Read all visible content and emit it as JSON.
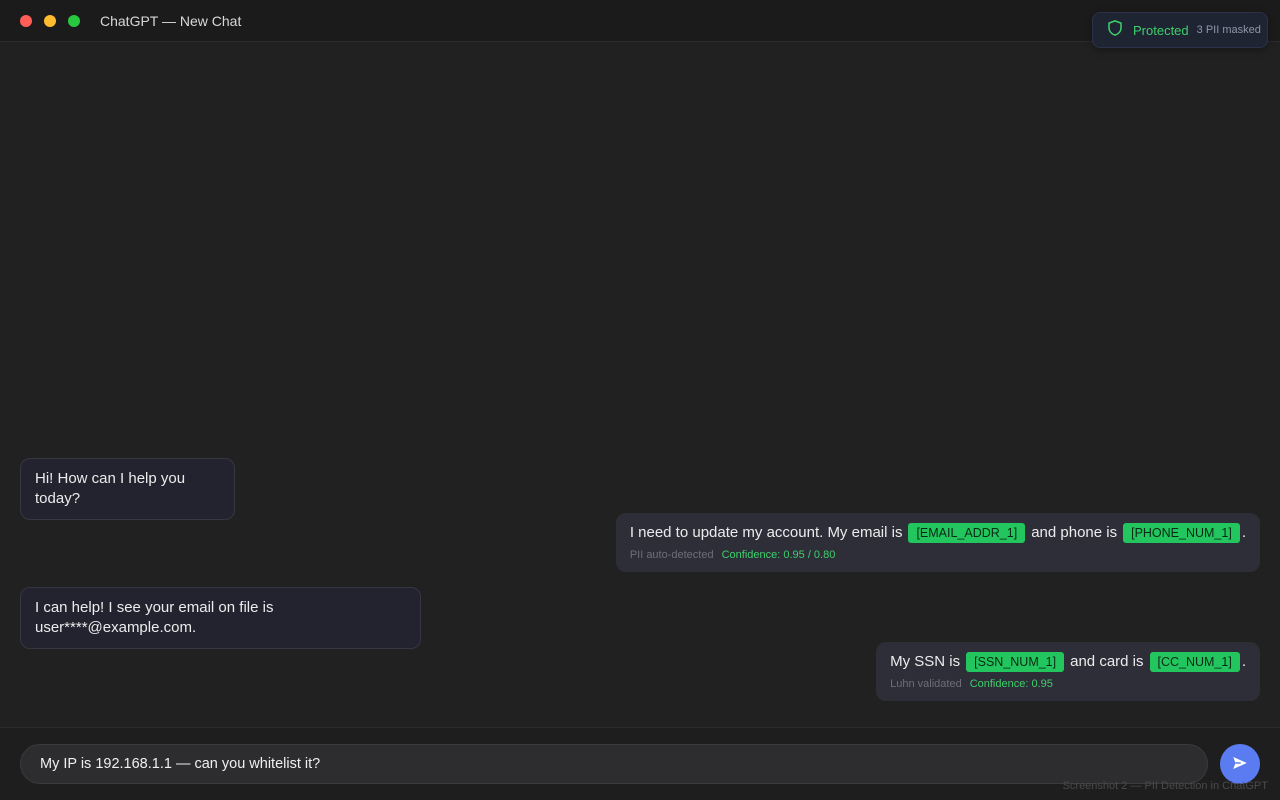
{
  "window": {
    "title": "ChatGPT — New Chat"
  },
  "badge": {
    "label": "Protected",
    "count": "3 PII masked",
    "color": "#3ecf6b"
  },
  "messages": [
    {
      "role": "assistant",
      "text": "Hi! How can I help you today?"
    },
    {
      "role": "user",
      "parts": [
        "I need to update my account. My email is",
        "[EMAIL_ADDR_1]",
        "and phone is",
        "[PHONE_NUM_1]",
        "."
      ],
      "note": "PII auto-detected",
      "confidence": "Confidence: 0.95 / 0.80"
    },
    {
      "role": "assistant",
      "text": "I can help! I see your email on file is user****@example.com."
    },
    {
      "role": "user",
      "parts": [
        "My SSN is",
        "[SSN_NUM_1]",
        "and card is",
        "[CC_NUM_1]",
        "."
      ],
      "note": "Luhn validated",
      "confidence": "Confidence: 0.95"
    }
  ],
  "composer": {
    "value": "My IP is 192.168.1.1 — can you whitelist it?",
    "send_icon": "send-icon"
  },
  "footer": "Screenshot 2 — PII Detection in ChatGPT",
  "colors": {
    "mask_pill": "#22c55e",
    "send_button": "#5b7cf0"
  }
}
